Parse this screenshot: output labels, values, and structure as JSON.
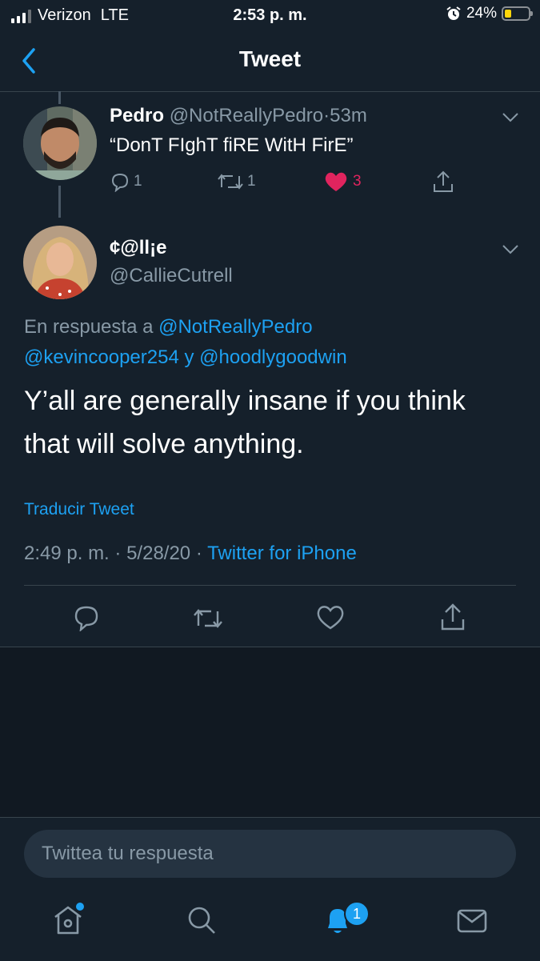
{
  "status_bar": {
    "carrier": "Verizon",
    "network": "LTE",
    "time": "2:53 p. m.",
    "battery": "24%",
    "battery_level": 0.24,
    "battery_color": "#ffd60a"
  },
  "nav": {
    "title": "Tweet",
    "back_icon": "chevron-left-icon"
  },
  "parent_tweet": {
    "name": "Pedro",
    "handle": "@NotReallyPedro",
    "separator": "·",
    "time": "53m",
    "text": "“DonT FIghT fiRE WitH FirE”",
    "reply_count": "1",
    "retweet_count": "1",
    "like_count": "3",
    "like_color": "#e0245e"
  },
  "main_tweet": {
    "name": "¢@ll¡e",
    "handle": "@CallieCutrell",
    "reply_prefix": "En respuesta a",
    "reply_user_1": "@NotReallyPedro",
    "reply_user_2": "@kevincooper254",
    "reply_and": "y",
    "reply_user_3": "@hoodlygoodwin",
    "text": "Y’all are generally insane if you think that will solve anything.",
    "translate": "Traducir Tweet",
    "time": "2:49 p. m.",
    "date": "5/28/20",
    "dot": "·",
    "source": "Twitter for iPhone"
  },
  "compose": {
    "placeholder": "Twittea tu respuesta"
  },
  "tab_bar": {
    "notifications_badge": "1",
    "accent": "#1da1f2"
  }
}
